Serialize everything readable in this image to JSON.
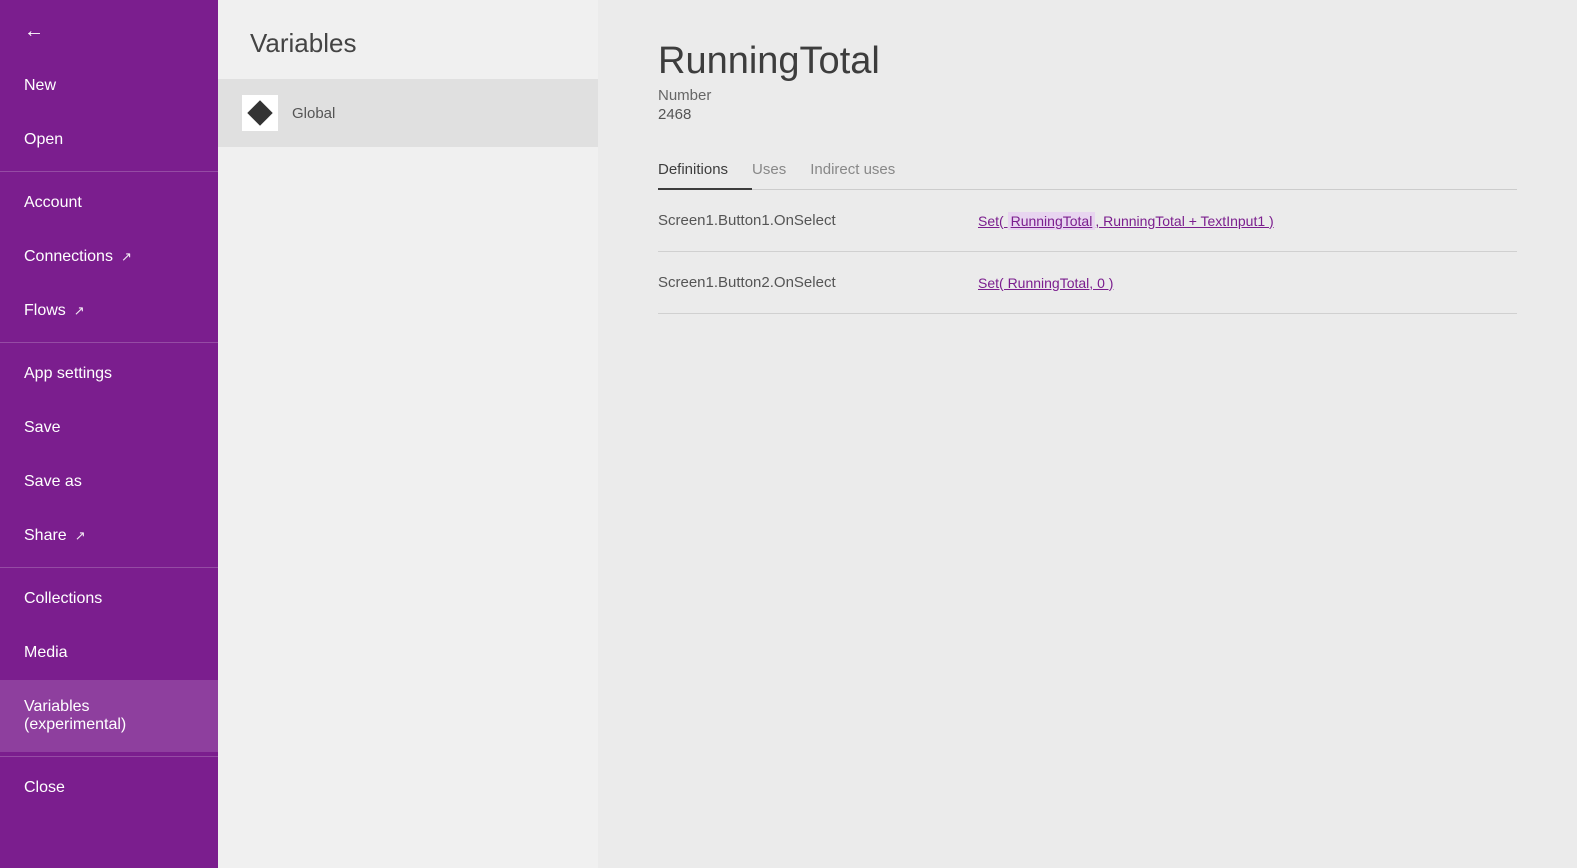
{
  "sidebar": {
    "back_label": "←",
    "items": [
      {
        "id": "new",
        "label": "New",
        "external": false
      },
      {
        "id": "open",
        "label": "Open",
        "external": false
      },
      {
        "id": "account",
        "label": "Account",
        "external": false
      },
      {
        "id": "connections",
        "label": "Connections",
        "external": true
      },
      {
        "id": "flows",
        "label": "Flows",
        "external": true
      },
      {
        "id": "app-settings",
        "label": "App settings",
        "external": false
      },
      {
        "id": "save",
        "label": "Save",
        "external": false
      },
      {
        "id": "save-as",
        "label": "Save as",
        "external": false
      },
      {
        "id": "share",
        "label": "Share",
        "external": true
      },
      {
        "id": "collections",
        "label": "Collections",
        "external": false
      },
      {
        "id": "media",
        "label": "Media",
        "external": false
      },
      {
        "id": "variables",
        "label": "Variables (experimental)",
        "external": false,
        "active": true
      },
      {
        "id": "close",
        "label": "Close",
        "external": false
      }
    ]
  },
  "middle_panel": {
    "title": "Variables",
    "global_label": "Global"
  },
  "main": {
    "variable_name": "RunningTotal",
    "variable_type": "Number",
    "variable_value": "2468",
    "tabs": [
      {
        "id": "definitions",
        "label": "Definitions",
        "active": true
      },
      {
        "id": "uses",
        "label": "Uses",
        "active": false
      },
      {
        "id": "indirect-uses",
        "label": "Indirect uses",
        "active": false
      }
    ],
    "definitions": [
      {
        "location": "Screen1.Button1.OnSelect",
        "formula_prefix": "Set( ",
        "formula_highlighted": "RunningTotal",
        "formula_suffix": ", RunningTotal + TextInput1 )"
      },
      {
        "location": "Screen1.Button2.OnSelect",
        "formula_prefix": "Set( RunningTotal, 0 )",
        "formula_highlighted": "",
        "formula_suffix": ""
      }
    ]
  }
}
